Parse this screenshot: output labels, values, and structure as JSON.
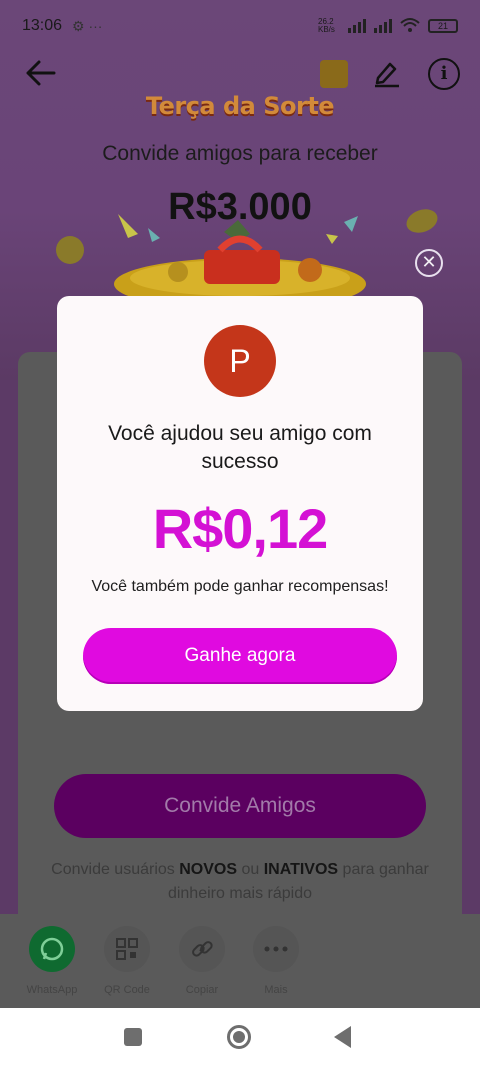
{
  "status_bar": {
    "time": "13:06",
    "left_indicators": "⚙ ···",
    "network": "26.2 KB/s",
    "battery": "21"
  },
  "header": {
    "logo_text": "Terça da Sorte",
    "headline": "Convide amigos para receber",
    "amount": "R$3.000"
  },
  "modal": {
    "avatar_letter": "P",
    "title": "Você ajudou seu amigo com sucesso",
    "amount": "R$0,12",
    "subtitle": "Você também pode ganhar recompensas!",
    "cta_label": "Ganhe agora"
  },
  "main": {
    "invite_button_label": "Convide Amigos",
    "caption_part1": "Convide usuários ",
    "caption_bold1": "NOVOS",
    "caption_part2": " ou ",
    "caption_bold2": "INATIVOS",
    "caption_part3": " para ganhar dinheiro mais rápido"
  },
  "share": {
    "items": [
      {
        "label": "WhatsApp",
        "icon": "whatsapp-icon"
      },
      {
        "label": "QR Code",
        "icon": "qr-code-icon"
      },
      {
        "label": "Copiar",
        "icon": "link-icon"
      },
      {
        "label": "Mais",
        "icon": "more-icon"
      }
    ]
  },
  "colors": {
    "accent": "#e00ae0",
    "amount": "#d411d4",
    "avatar": "#c4361a"
  }
}
